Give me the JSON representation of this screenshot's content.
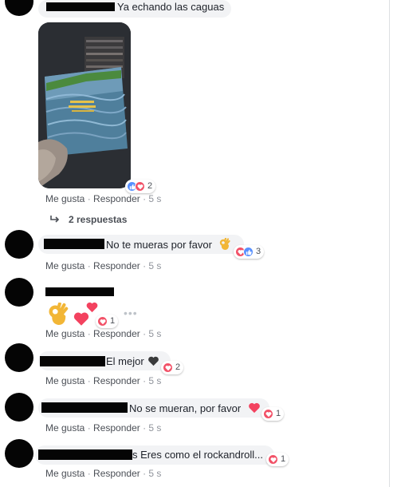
{
  "theme": {
    "text": "#1d2129",
    "meta": "#90949c",
    "link": "#4b4f56",
    "bubble": "#f2f3f5",
    "like_blue": "#5890ff",
    "love_red": "#f25268"
  },
  "comments": [
    {
      "text": "Ya echando las caguas",
      "reactions": {
        "icons": [
          "like-icon",
          "love-icon"
        ],
        "count": "2"
      },
      "actions": {
        "like": "Me gusta",
        "reply": "Responder",
        "time": "5 s"
      },
      "replies_label": "2 respuestas"
    },
    {
      "text": "No te mueras por favor",
      "emoji": "ok-hand-emoji",
      "reactions": {
        "icons": [
          "love-icon",
          "like-icon"
        ],
        "count": "3"
      },
      "actions": {
        "like": "Me gusta",
        "reply": "Responder",
        "time": "5 s"
      }
    },
    {
      "text": "",
      "stickers": [
        "ok-hand-emoji",
        "heart-emoji",
        "heart-emoji"
      ],
      "reactions": {
        "icons": [
          "love-icon"
        ],
        "count": "1"
      },
      "more": "•••",
      "actions": {
        "like": "Me gusta",
        "reply": "Responder",
        "time": "5 s"
      }
    },
    {
      "text": "El mejor",
      "emoji": "black-heart-emoji",
      "reactions": {
        "icons": [
          "love-icon"
        ],
        "count": "2"
      },
      "actions": {
        "like": "Me gusta",
        "reply": "Responder",
        "time": "5 s"
      }
    },
    {
      "text": "No se mueran, por favor",
      "emoji": "heart-emoji",
      "reactions": {
        "icons": [
          "love-icon"
        ],
        "count": "1"
      },
      "actions": {
        "like": "Me gusta",
        "reply": "Responder",
        "time": "5 s"
      }
    },
    {
      "text": "s Eres como el rockandroll...",
      "reactions": {
        "icons": [
          "love-icon"
        ],
        "count": "1"
      },
      "actions": {
        "like": "Me gusta",
        "reply": "Responder",
        "time": "5 s"
      }
    }
  ]
}
